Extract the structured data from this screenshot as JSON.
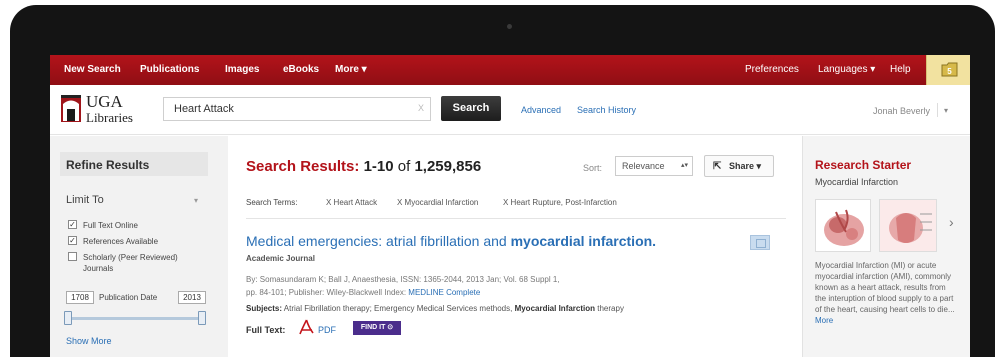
{
  "topnav": {
    "left_items": [
      "New Search",
      "Publications",
      "Images",
      "eBooks",
      "More ▾"
    ],
    "right_items": [
      "Preferences",
      "Languages ▾",
      "Help"
    ],
    "folder_count": "5"
  },
  "header": {
    "logo_uga": "UGA",
    "logo_libraries": "Libraries",
    "search_value": "Heart Attack",
    "search_clear": "X",
    "search_button": "Search",
    "advanced": "Advanced",
    "search_history": "Search History",
    "user_name": "Jonah Beverly",
    "user_caret": "▾"
  },
  "sidebar": {
    "refine_title": "Refine Results",
    "limit_to": "Limit To",
    "limit_caret": "▾",
    "limits": [
      {
        "label": "Full Text Online",
        "checked": true
      },
      {
        "label": "References Available",
        "checked": true
      },
      {
        "label": "Scholarly (Peer Reviewed)",
        "label2": "Journals",
        "checked": false
      }
    ],
    "date_from": "1708",
    "date_label": "Publication Date",
    "date_to": "2013",
    "show_more": "Show More"
  },
  "main": {
    "results_label": "Search Results:",
    "results_range": "1-10",
    "results_of": "of",
    "results_total": "1,259,856",
    "sort_label": "Sort:",
    "sort_value": "Relevance",
    "share_label": "Share ▾",
    "terms_label": "Search Terms:",
    "terms": [
      "X Heart Attack",
      "X Myocardial Infarction",
      "X Heart Rupture, Post-Infarction"
    ],
    "result": {
      "title_plain": "Medical emergencies: atrial fibrillation and ",
      "title_bold": "myocardial infarction.",
      "doc_type": "Academic Journal",
      "byline1": "By: Somasundaram K; Ball J, Anaesthesia, ISSN: 1365-2044, 2013 Jan; Vol. 68 Suppl 1,",
      "byline2_prefix": "pp. 84-101; Publisher: Wiley-Blackwell Index: ",
      "byline2_link": "MEDLINE Complete",
      "subjects_label": "Subjects:",
      "subjects_plain": " Atrial Fibrillation therapy; Emergency Medical Services methods, ",
      "subjects_bold": "Myocardial Infarction",
      "subjects_tail": " therapy",
      "fulltext_label": "Full Text:",
      "pdf_label": "PDF",
      "findit_label": "FIND IT ⊙"
    }
  },
  "research_starter": {
    "title": "Research Starter",
    "subtitle": "Myocardial Infarction",
    "next": "›",
    "text": "Myocardial Infarction (MI) or acute myocardial infarction (AMI), commonly known as a heart attack, results from the interuption of blood supply to a part of the heart, causing heart cells to die...",
    "more": "More"
  },
  "colors": {
    "brand_red": "#b3131a",
    "link_blue": "#2a6fb5",
    "findit_purple": "#4b2d8c",
    "folder_yellow": "#f2e2a0"
  }
}
